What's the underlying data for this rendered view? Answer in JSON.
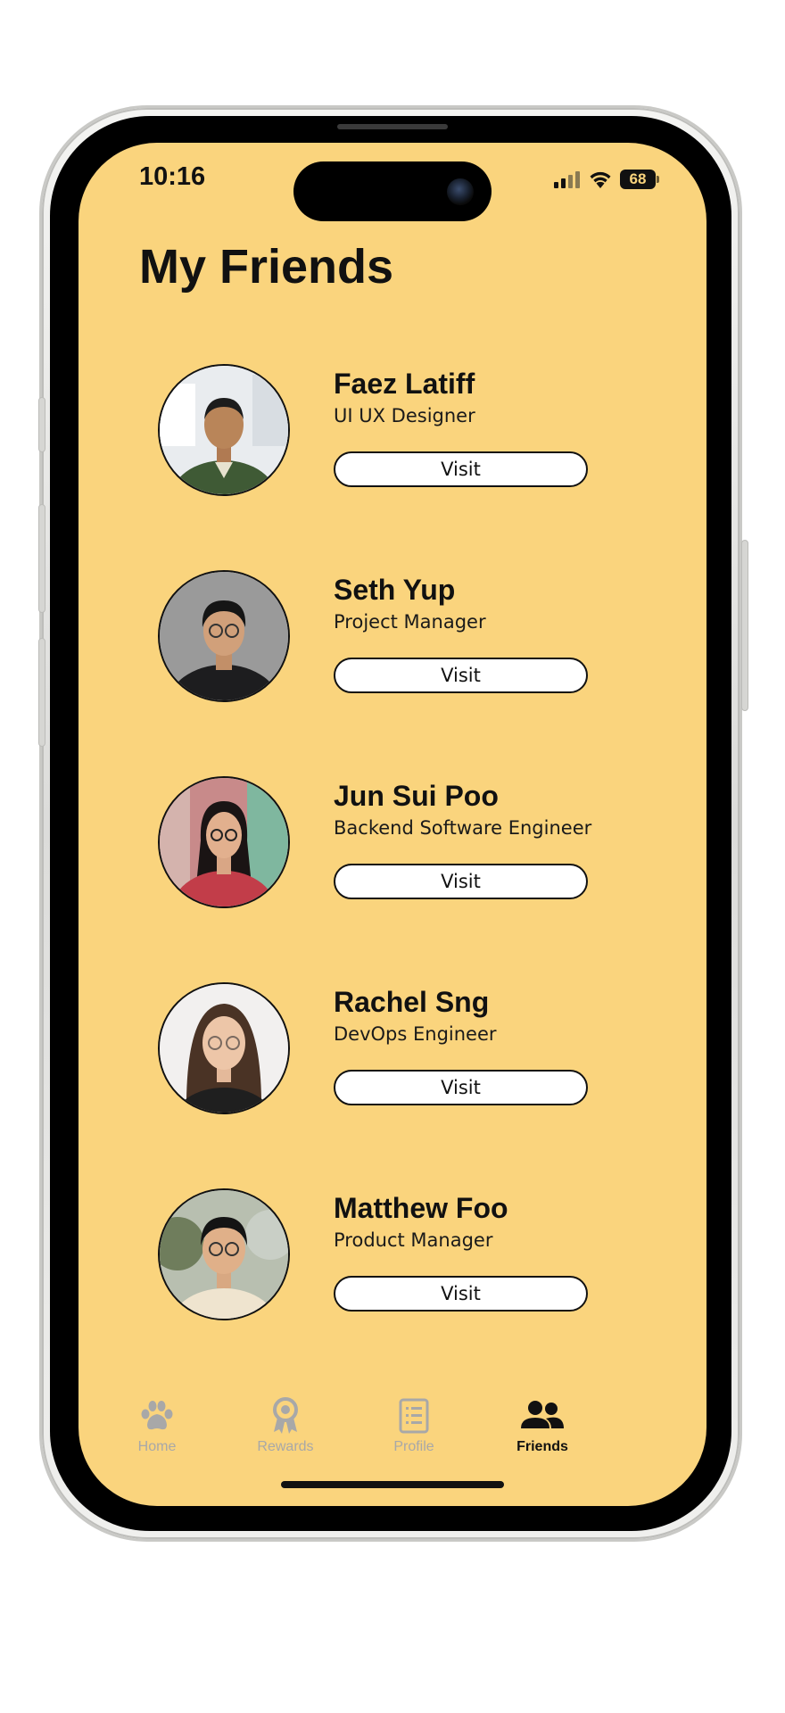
{
  "status_bar": {
    "time": "10:16",
    "battery": "68",
    "icons": [
      "signal-icon",
      "wifi-icon",
      "battery-icon"
    ]
  },
  "page": {
    "title": "My Friends"
  },
  "friends": [
    {
      "name": "Faez Latiff",
      "role": "UI UX Designer",
      "visit_label": "Visit"
    },
    {
      "name": "Seth Yup",
      "role": "Project Manager",
      "visit_label": "Visit"
    },
    {
      "name": "Jun Sui Poo",
      "role": "Backend Software Engineer",
      "visit_label": "Visit"
    },
    {
      "name": "Rachel Sng",
      "role": "DevOps Engineer",
      "visit_label": "Visit"
    },
    {
      "name": "Matthew Foo",
      "role": "Product Manager",
      "visit_label": "Visit"
    }
  ],
  "tab_bar": {
    "active": "Friends",
    "tabs": [
      {
        "label": "Home",
        "icon": "paw-icon"
      },
      {
        "label": "Rewards",
        "icon": "award-ribbon-icon"
      },
      {
        "label": "Profile",
        "icon": "list-document-icon"
      },
      {
        "label": "Friends",
        "icon": "people-icon"
      }
    ]
  },
  "colors": {
    "background": "#fad47d",
    "text": "#111111",
    "inactive_tab": "#a8a8a8",
    "button_fill": "#ffffff"
  }
}
